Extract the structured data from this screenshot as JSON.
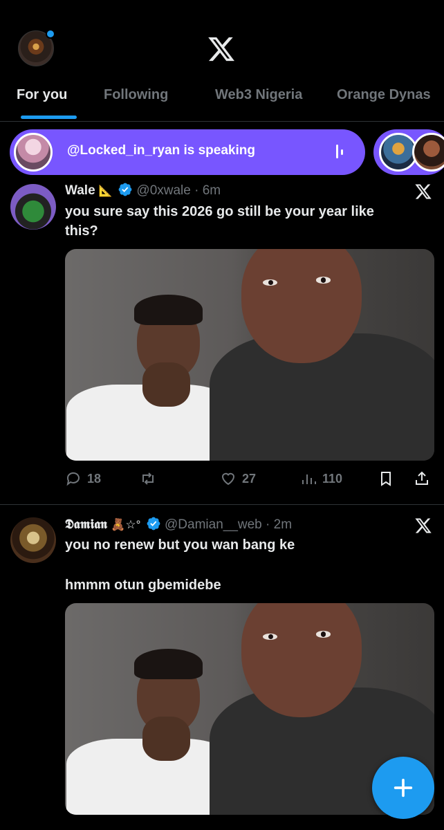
{
  "header": {
    "avatar_icon": "profile-avatar-icon",
    "logo_icon": "x-logo-icon"
  },
  "tabs": [
    {
      "label": "For you",
      "active": true
    },
    {
      "label": "Following",
      "active": false
    },
    {
      "label": "Web3 Nigeria",
      "active": false
    },
    {
      "label": "Orange Dynas",
      "active": false
    }
  ],
  "space": {
    "text": "@Locked_in_ryan is speaking",
    "color": "#7856ff"
  },
  "tweets": [
    {
      "name": "Wale",
      "name_emoji": "📐",
      "verified": true,
      "handle": "@0xwale",
      "time": "6m",
      "sep": "·",
      "lines": [
        "you sure say this 2026 go still be your year like",
        "this?"
      ],
      "replies": "18",
      "retweets": "",
      "likes": "27",
      "views": "110"
    },
    {
      "name": "𝕯𝖆𝖒𝖎𝖆𝖓",
      "name_emoji": "🧸☆°",
      "verified": true,
      "handle": "@Damian__web",
      "time": "2m",
      "sep": "·",
      "lines": [
        "you no renew but you wan bang ke",
        "hmmm otun gbemidebe"
      ]
    }
  ],
  "colors": {
    "accent": "#1d9bf0",
    "muted": "#71767b",
    "background": "#000000"
  }
}
